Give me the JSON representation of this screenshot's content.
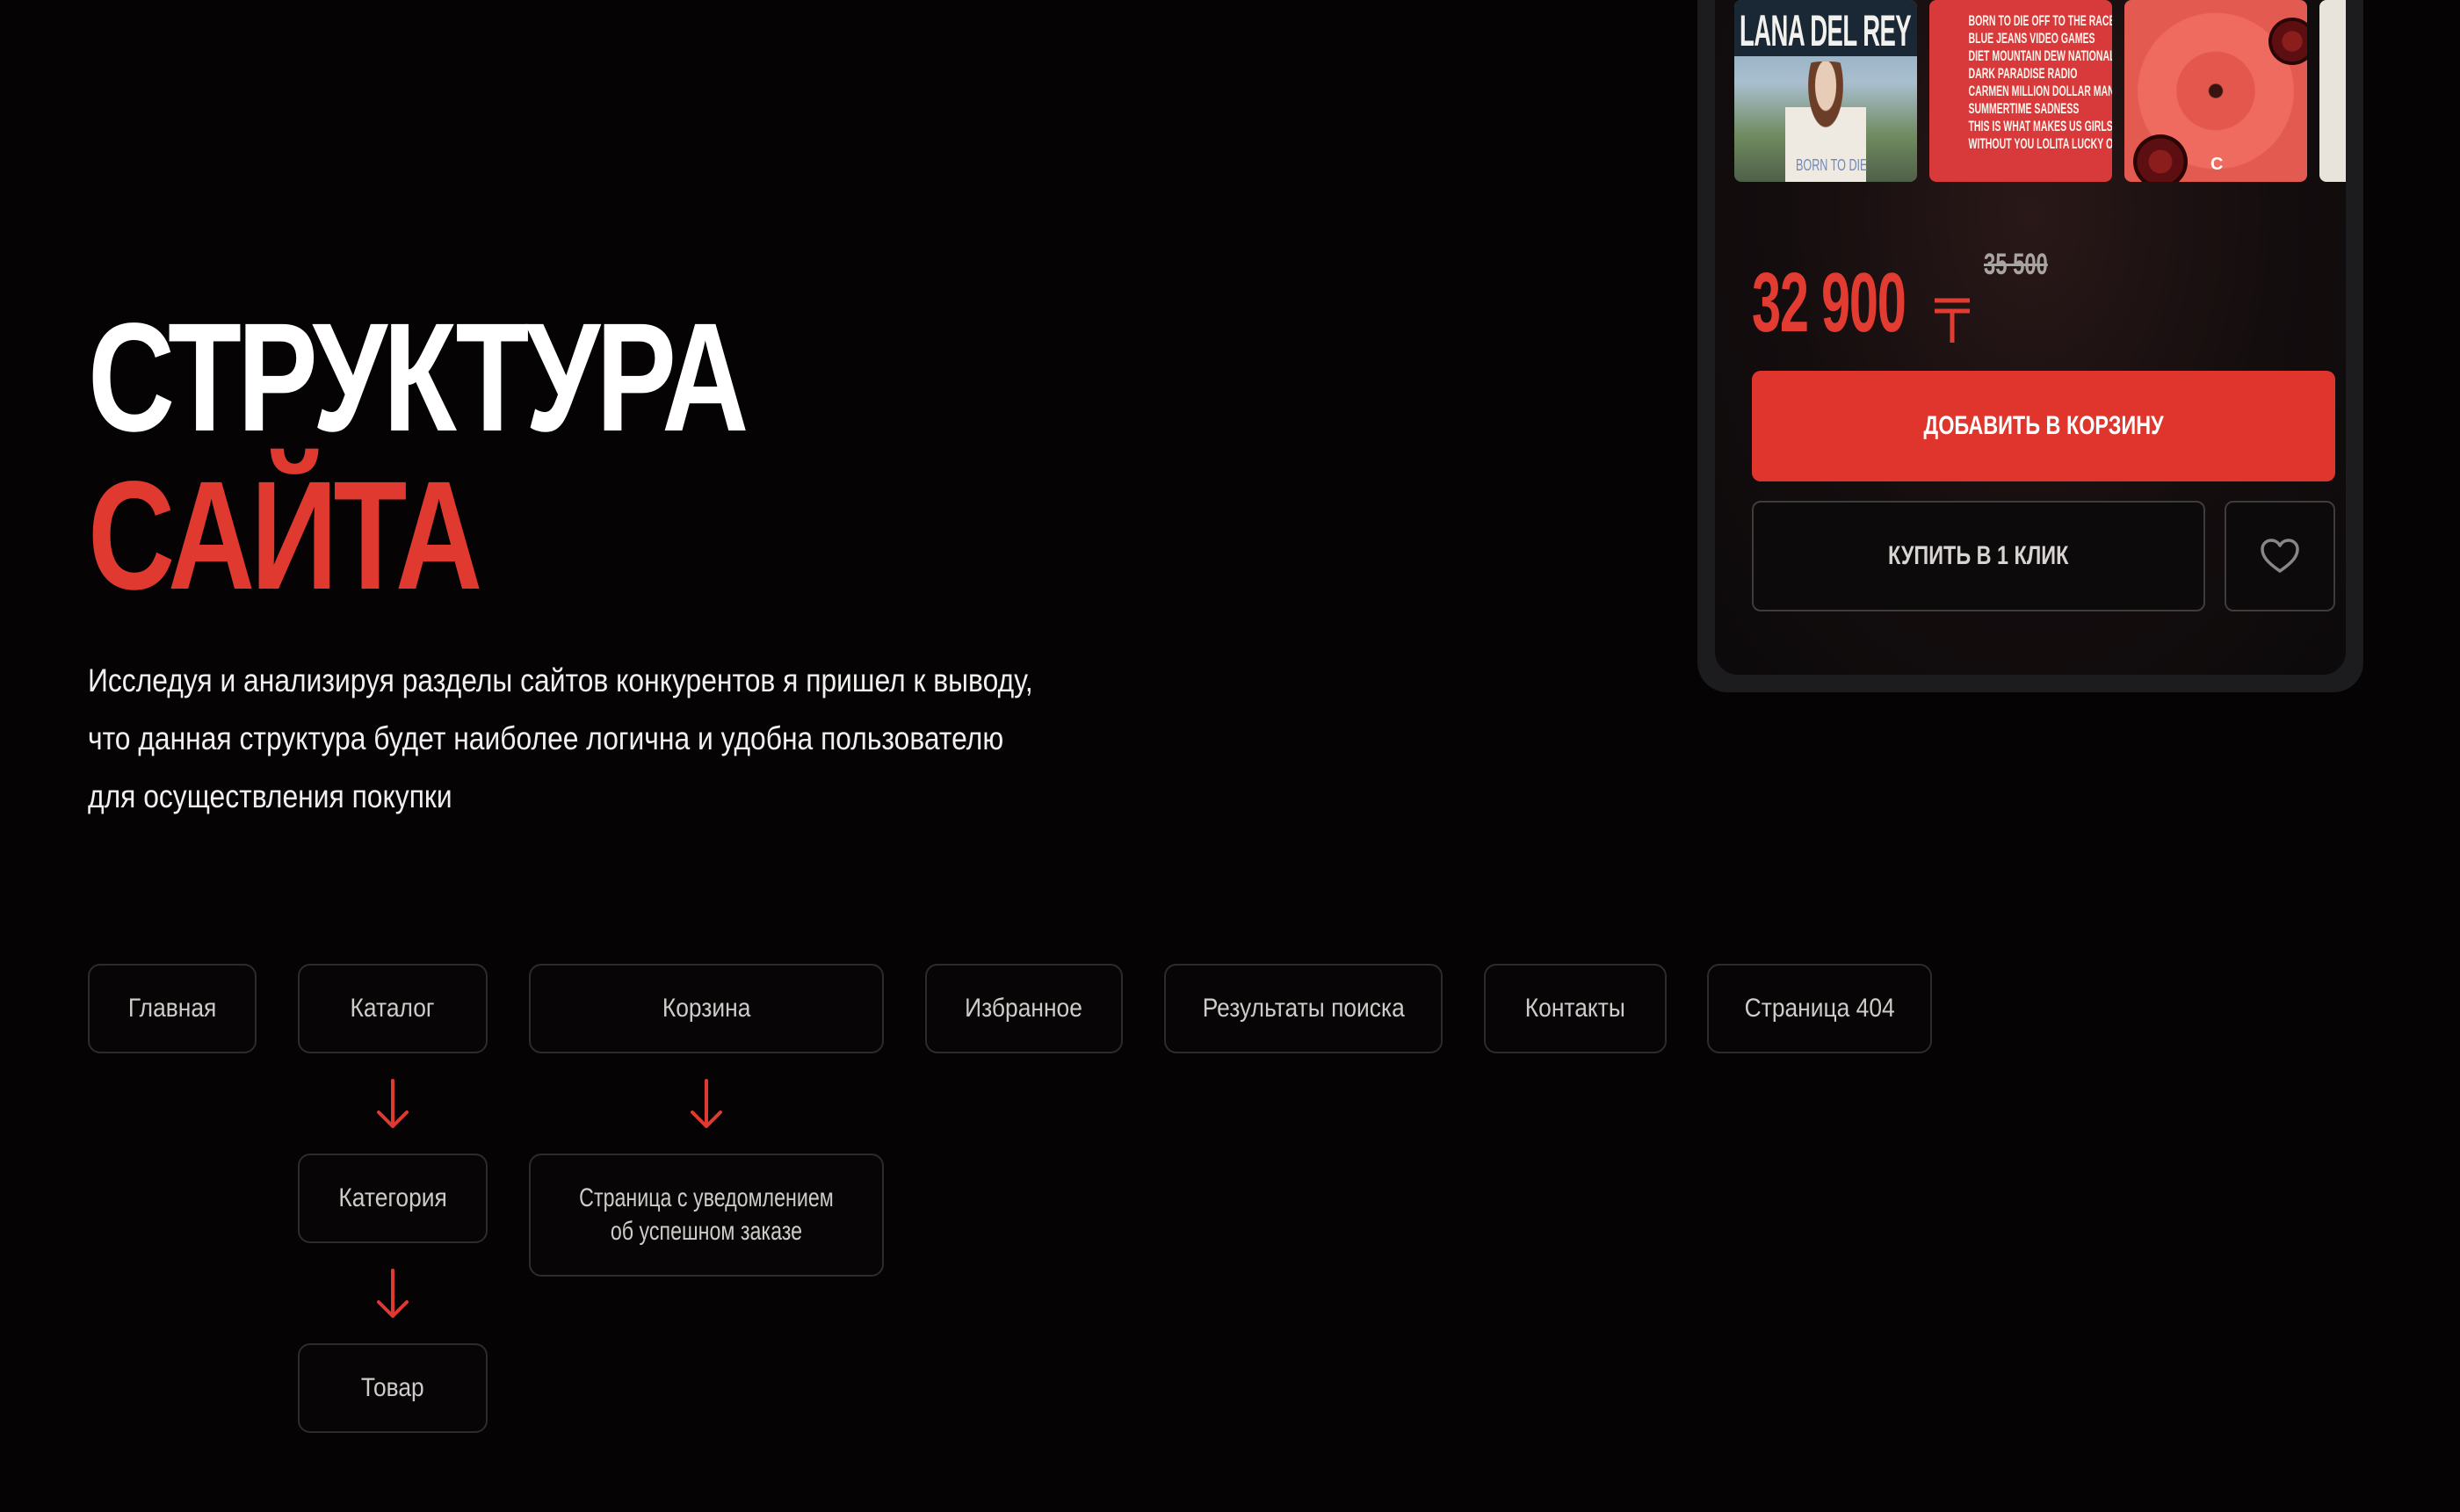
{
  "header": {
    "title_line1": "СТРУКТУРА",
    "title_line2": "САЙТА"
  },
  "intro": {
    "lines": [
      "Исследуя  и анализируя разделы сайтов конкурентов я пришел к выводу,",
      "что данная структура будет наиболее логична и удобна пользователю",
      "для осуществления покупки"
    ]
  },
  "structure": {
    "nodes": {
      "home": "Главная",
      "catalog": "Каталог",
      "cart": "Корзина",
      "favorites": "Избранное",
      "search": "Результаты поиска",
      "contacts": "Контакты",
      "page404": "Страница 404",
      "category": "Категория",
      "order_success_line1": "Страница с уведомлением",
      "order_success_line2": "об успешном заказе",
      "product": "Товар"
    },
    "edges": [
      [
        "catalog",
        "category"
      ],
      [
        "category",
        "product"
      ],
      [
        "cart",
        "order_success"
      ]
    ],
    "arrow_color": "#e03a30"
  },
  "product_card": {
    "covers": {
      "cover1_title": "LANA DEL REY",
      "cover1_subtitle": "BORN TO DIE",
      "cover2_tracks": [
        "BORN TO DIE  OFF TO THE RACES",
        "BLUE JEANS  VIDEO GAMES",
        "DIET MOUNTAIN DEW  NATIONAL ANTHEM",
        "DARK PARADISE  RADIO",
        "CARMEN  MILLION DOLLAR MAN",
        "SUMMERTIME SADNESS",
        "THIS IS WHAT MAKES US GIRLS",
        "WITHOUT YOU  LOLITA  LUCKY ONES"
      ],
      "cover3_label": "C"
    },
    "price": "32 900",
    "old_price": "35 500",
    "currency_icon": "tenge-icon",
    "add_to_cart_label": "ДОБАВИТЬ В КОРЗИНУ",
    "buy_one_click_label": "КУПИТЬ В 1 КЛИК",
    "favorite_icon": "heart-icon",
    "accent_color": "#e0352d"
  }
}
